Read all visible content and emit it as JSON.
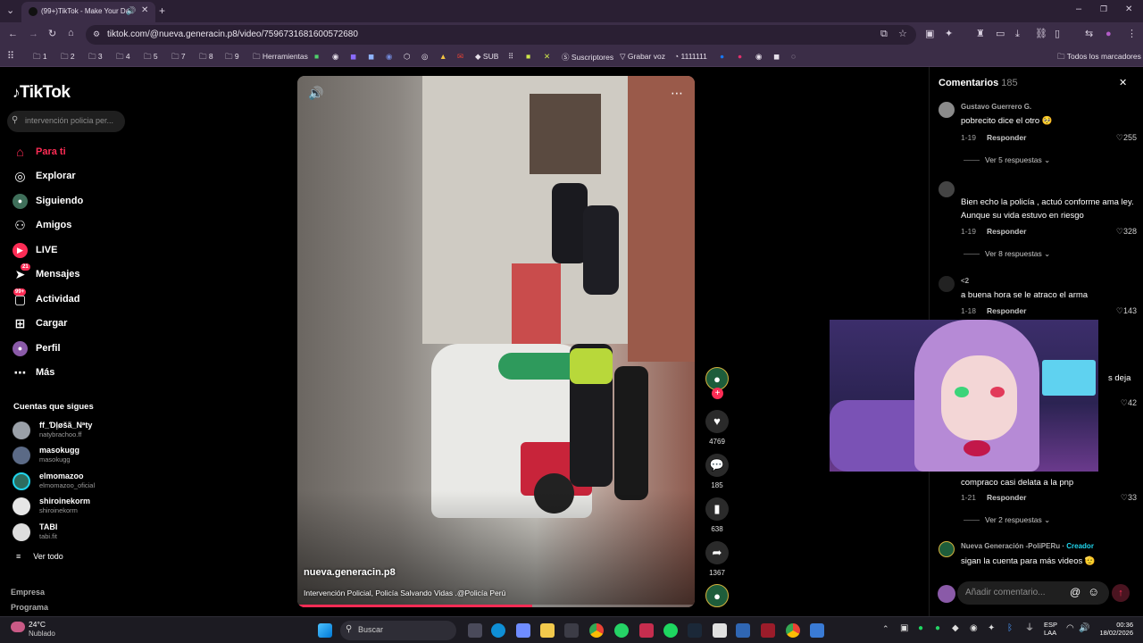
{
  "browser": {
    "tab_title": "(99+)TikTok - Make Your Da",
    "url": "tiktok.com/@nueva.generacin.p8/video/7596731681600572680",
    "bookmarks": [
      "1",
      "2",
      "3",
      "4",
      "5",
      "7",
      "8",
      "9",
      "Herramientas",
      "SUB",
      "Suscriptores",
      "Grabar voz",
      "1111111",
      "Todos los marcadores"
    ]
  },
  "tiktok": {
    "logo": "TikTok",
    "search_placeholder": "intervención policia per...",
    "nav": [
      {
        "label": "Para ti",
        "icon": "home-icon",
        "active": true
      },
      {
        "label": "Explorar",
        "icon": "compass-icon"
      },
      {
        "label": "Siguiendo",
        "icon": "following-icon"
      },
      {
        "label": "Amigos",
        "icon": "friends-icon"
      },
      {
        "label": "LIVE",
        "icon": "live-icon"
      },
      {
        "label": "Mensajes",
        "icon": "messages-icon",
        "badge": "21"
      },
      {
        "label": "Actividad",
        "icon": "activity-icon",
        "badge": "99+"
      },
      {
        "label": "Cargar",
        "icon": "upload-icon"
      },
      {
        "label": "Perfil",
        "icon": "profile-icon"
      },
      {
        "label": "Más",
        "icon": "more-icon"
      }
    ],
    "following_title": "Cuentas que sigues",
    "following": [
      {
        "name": "ff_Ɗļøšã_Nªty",
        "handle": "natybrachoo.ff"
      },
      {
        "name": "masokugg",
        "handle": "masokugg"
      },
      {
        "name": "elmomazoo",
        "handle": "elmomazoo_oficial"
      },
      {
        "name": "shiroinekorm",
        "handle": "shiroinekorm"
      },
      {
        "name": "TABI",
        "handle": "tabi.fit"
      }
    ],
    "see_all": "Ver todo",
    "footer": [
      "Empresa",
      "Programa"
    ]
  },
  "video": {
    "author": "nueva.generacin.p8",
    "description": "Intervención Policial, Policía Salvando Vidas .@Policía Perú",
    "progress": 0.59,
    "likes": "4769",
    "comments": "185",
    "saves": "638",
    "shares": "1367"
  },
  "comments": {
    "title": "Comentarios",
    "count": "185",
    "items": [
      {
        "name": "Gustavo Guerrero G.",
        "text": "pobrecito dice el otro 🥺",
        "date": "1-19",
        "reply": "Responder",
        "likes": "255",
        "more": "Ver 5 respuestas"
      },
      {
        "name": "",
        "text": "Bien echo la policía , actuó conforme ama ley. Aunque su vida estuvo en riesgo",
        "date": "1-19",
        "reply": "Responder",
        "likes": "328",
        "more": "Ver 8 respuestas"
      },
      {
        "name": "<2",
        "text": "a buena hora se le atraco el arma",
        "date": "1-18",
        "reply": "Responder",
        "likes": "143"
      },
      {
        "name": "",
        "text": "s deja",
        "likes": "42"
      },
      {
        "name": "",
        "text": "compraco casi delata a la pnp",
        "date": "1-21",
        "reply": "Responder",
        "likes": "33",
        "more": "Ver 2 respuestas"
      },
      {
        "name": "Nueva Generación -PoliPERu",
        "creator": "Creador",
        "text": "sigan la cuenta para más videos 🫡"
      }
    ],
    "input_placeholder": "Añadir comentario..."
  },
  "taskbar": {
    "weather_temp": "24°C",
    "weather_desc": "Nublado",
    "search": "Buscar",
    "lang": "ESP",
    "lang2": "LAA",
    "time": "00:36",
    "date": "18/02/2026"
  }
}
